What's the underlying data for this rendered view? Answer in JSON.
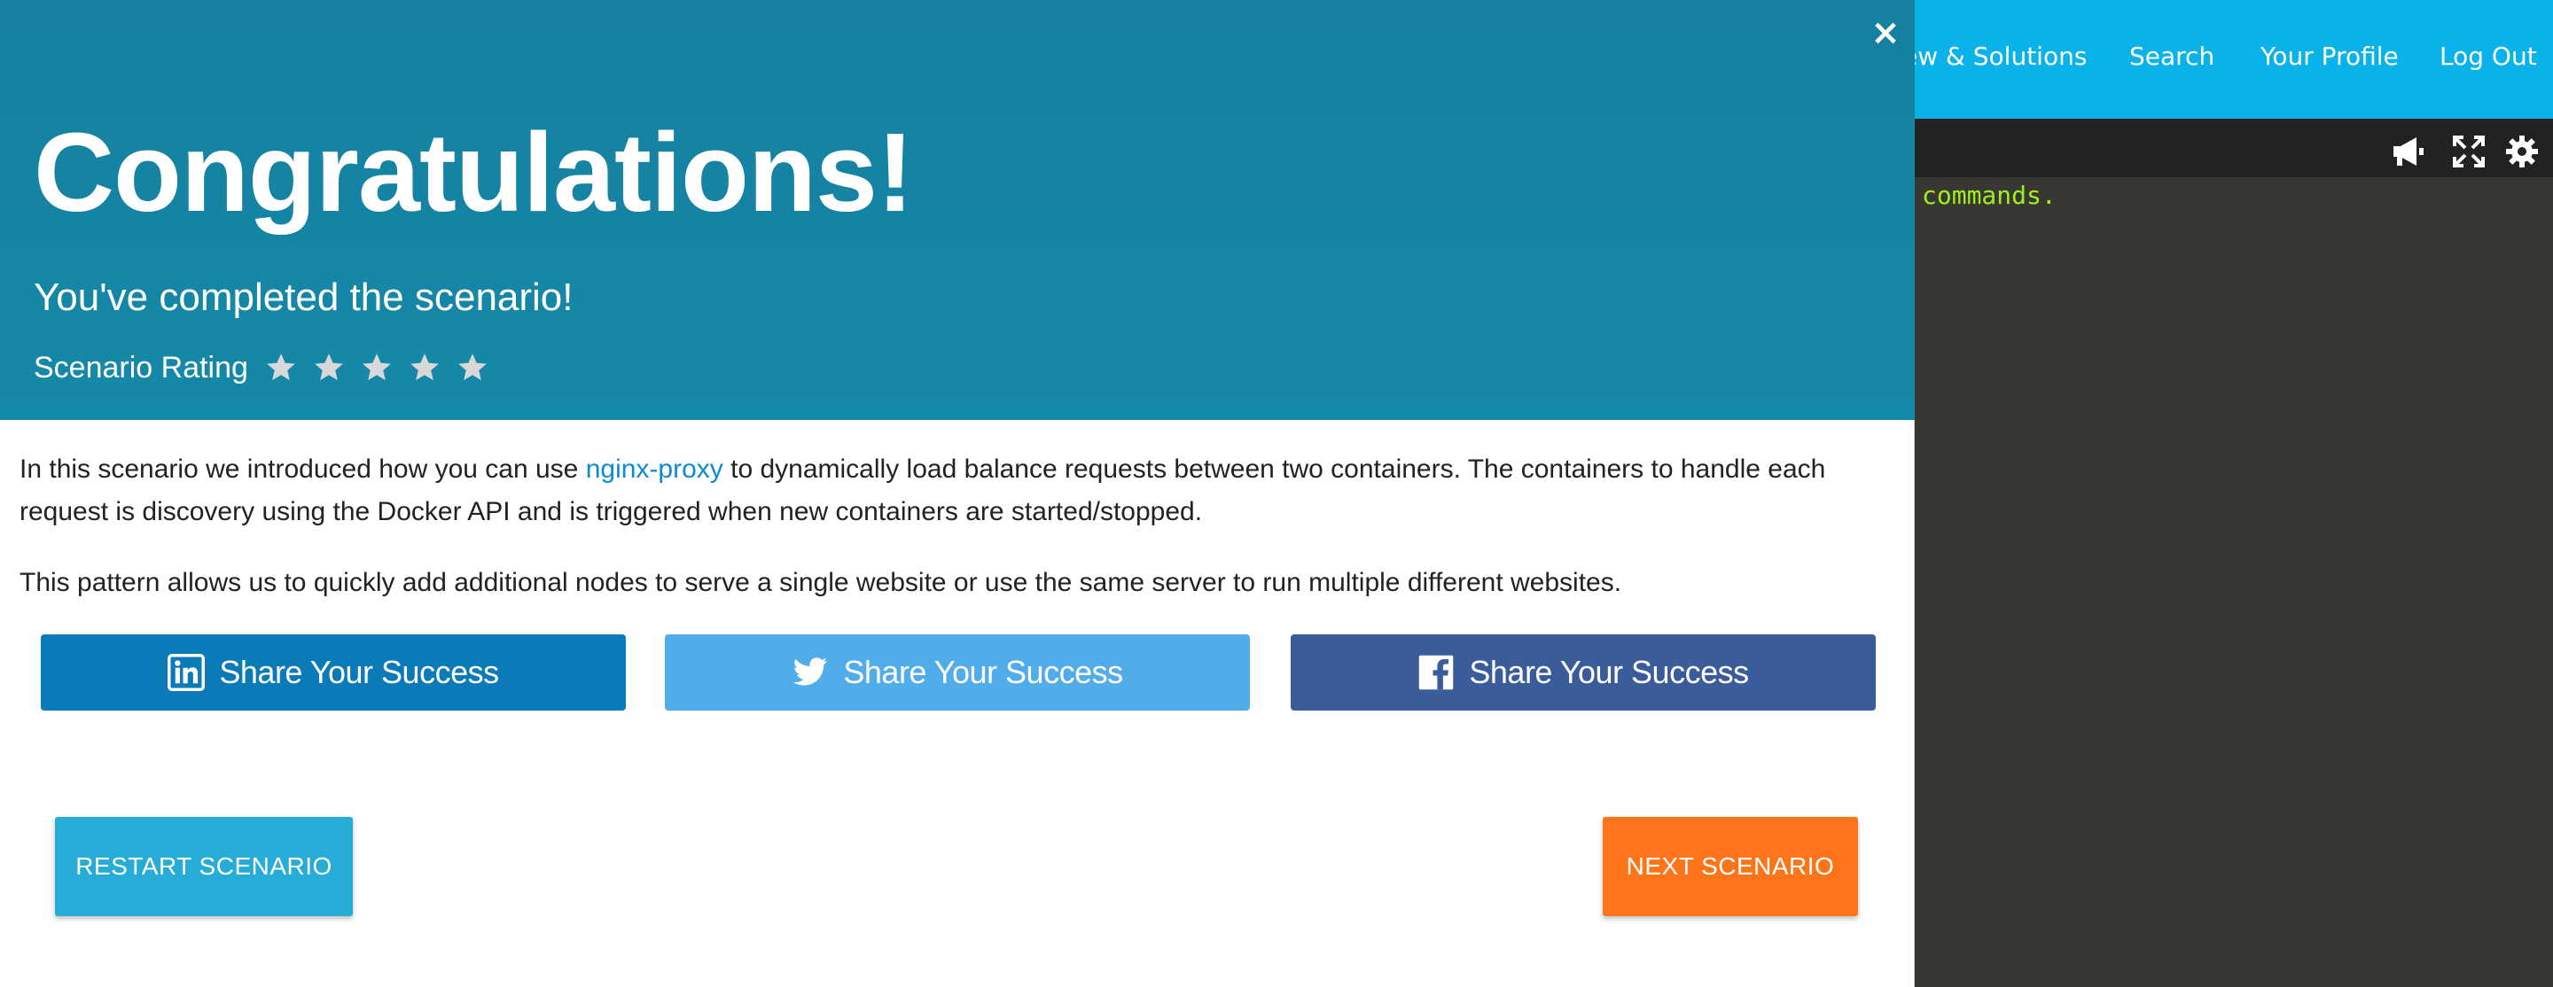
{
  "nav": {
    "items": [
      "ew & Solutions",
      "Search",
      "Your Profile",
      "Log Out"
    ]
  },
  "terminal": {
    "text": "commands.",
    "tools": [
      "megaphone-icon",
      "expand-icon",
      "gear-icon"
    ]
  },
  "modal": {
    "close_symbol": "×",
    "title": "Congratulations!",
    "subtitle": "You've completed the scenario!",
    "rating_label": "Scenario Rating",
    "rating_stars_max": 5,
    "paragraph1_before": "In this scenario we introduced how you can use ",
    "paragraph1_link": "nginx-proxy",
    "paragraph1_after": " to dynamically load balance requests between two containers. The containers to handle each request is discovery using the Docker API and is triggered when new containers are started/stopped.",
    "paragraph2": "This pattern allows us to quickly add additional nodes to serve a single website or use the same server to run multiple different websites.",
    "share": {
      "linkedin_label": "Share Your Success",
      "twitter_label": "Share Your Success",
      "facebook_label": "Share Your Success"
    },
    "restart_label": "RESTART SCENARIO",
    "next_label": "NEXT SCENARIO"
  },
  "colors": {
    "header_bg": "#1589a9",
    "topnav_bg": "#09b3ea",
    "linkedin": "#0a7ab8",
    "twitter": "#51acea",
    "facebook": "#3a5c9b",
    "restart": "#26acd6",
    "next": "#fd7419",
    "terminal_text": "#9ef01a"
  }
}
